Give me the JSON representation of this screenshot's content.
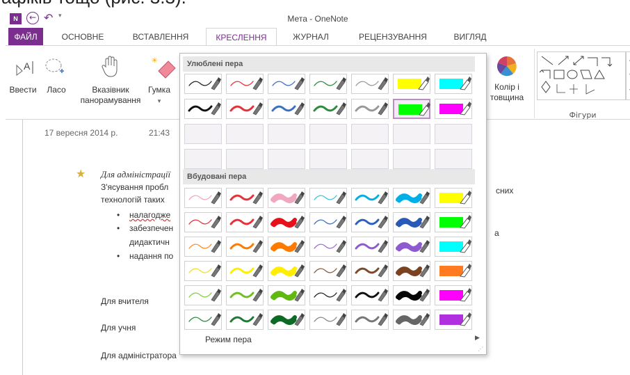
{
  "top_caption": "афіків тощо (рис. 3.3).",
  "app": {
    "title": "Мета - OneNote",
    "logo": "N"
  },
  "tabs": [
    {
      "label": "ФАЙЛ"
    },
    {
      "label": "ОСНОВНЕ"
    },
    {
      "label": "ВСТАВЛЕННЯ"
    },
    {
      "label": "КРЕСЛЕННЯ"
    },
    {
      "label": "ЖУРНАЛ"
    },
    {
      "label": "РЕЦЕНЗУВАННЯ"
    },
    {
      "label": "ВИГЛЯД"
    }
  ],
  "active_tab": "КРЕСЛЕННЯ",
  "ribbon": {
    "type_label": "Ввести",
    "lasso_label": "Ласо",
    "pan_label1": "Вказівник",
    "pan_label2": "панорамування",
    "eraser_label": "Гумка",
    "color_label1": "Колір і",
    "color_label2": "товщина",
    "shapes_group": "Фігури"
  },
  "note": {
    "date": "17 вересня 2014 р.",
    "time": "21:43",
    "heading": "Для адміністрації",
    "body1": "З'ясування пробл",
    "body1_end": "сних",
    "body2": "технологій таких",
    "bullets": [
      "налагодже",
      "забезпечен",
      "надання по"
    ],
    "bullet2_cont": "дидактичн",
    "bullet2_end": "а",
    "teacher": "Для вчителя",
    "student": "Для учня",
    "admin": "Для адміністратора"
  },
  "pen_menu": {
    "favorites_title": "Улюблені пера",
    "builtin_title": "Вбудовані пера",
    "pen_mode": "Режим пера",
    "favorites": [
      {
        "color": "#222222",
        "type": "thin"
      },
      {
        "color": "#e8303a",
        "type": "thin"
      },
      {
        "color": "#3a6fc4",
        "type": "thin"
      },
      {
        "color": "#2e8b3e",
        "type": "thin"
      },
      {
        "color": "#999999",
        "type": "thin"
      },
      {
        "color": "#ffff00",
        "type": "hl"
      },
      {
        "color": "#00ffff",
        "type": "hl"
      },
      {
        "color": "#111111",
        "type": "med"
      },
      {
        "color": "#e8303a",
        "type": "med"
      },
      {
        "color": "#3a6fc4",
        "type": "med"
      },
      {
        "color": "#2e8b3e",
        "type": "med"
      },
      {
        "color": "#999999",
        "type": "med"
      },
      {
        "color": "#00ff00",
        "type": "hl",
        "selected": true
      },
      {
        "color": "#ff00ff",
        "type": "hl"
      }
    ],
    "builtin": [
      [
        "#f0a8c0",
        "#e8303a",
        "#f0a8c0",
        "#40c0e0",
        "#00aee8",
        "#00aee8",
        "#ffff00"
      ],
      [
        "#e8303a",
        "#e8303a",
        "#e8101a",
        "#3a6fc4",
        "#2a60c0",
        "#2a5ab8",
        "#00ff00"
      ],
      [
        "#ff8c2a",
        "#ff7a00",
        "#ff7a00",
        "#9b6fd0",
        "#8e5ad0",
        "#8e5ad0",
        "#00ffff"
      ],
      [
        "#f0e020",
        "#ffee00",
        "#ffee00",
        "#8b5a3c",
        "#7a4a2a",
        "#7a4220",
        "#ff7a20"
      ],
      [
        "#80d040",
        "#70c020",
        "#60b810",
        "#222222",
        "#111111",
        "#050505",
        "#ff00ff"
      ],
      [
        "#2a8b3e",
        "#1e7a34",
        "#0c6a24",
        "#888888",
        "#777777",
        "#666666",
        "#b030e0"
      ]
    ],
    "builtin_types": [
      "thin",
      "med",
      "thick",
      "thin",
      "med",
      "thick",
      "hl"
    ]
  }
}
